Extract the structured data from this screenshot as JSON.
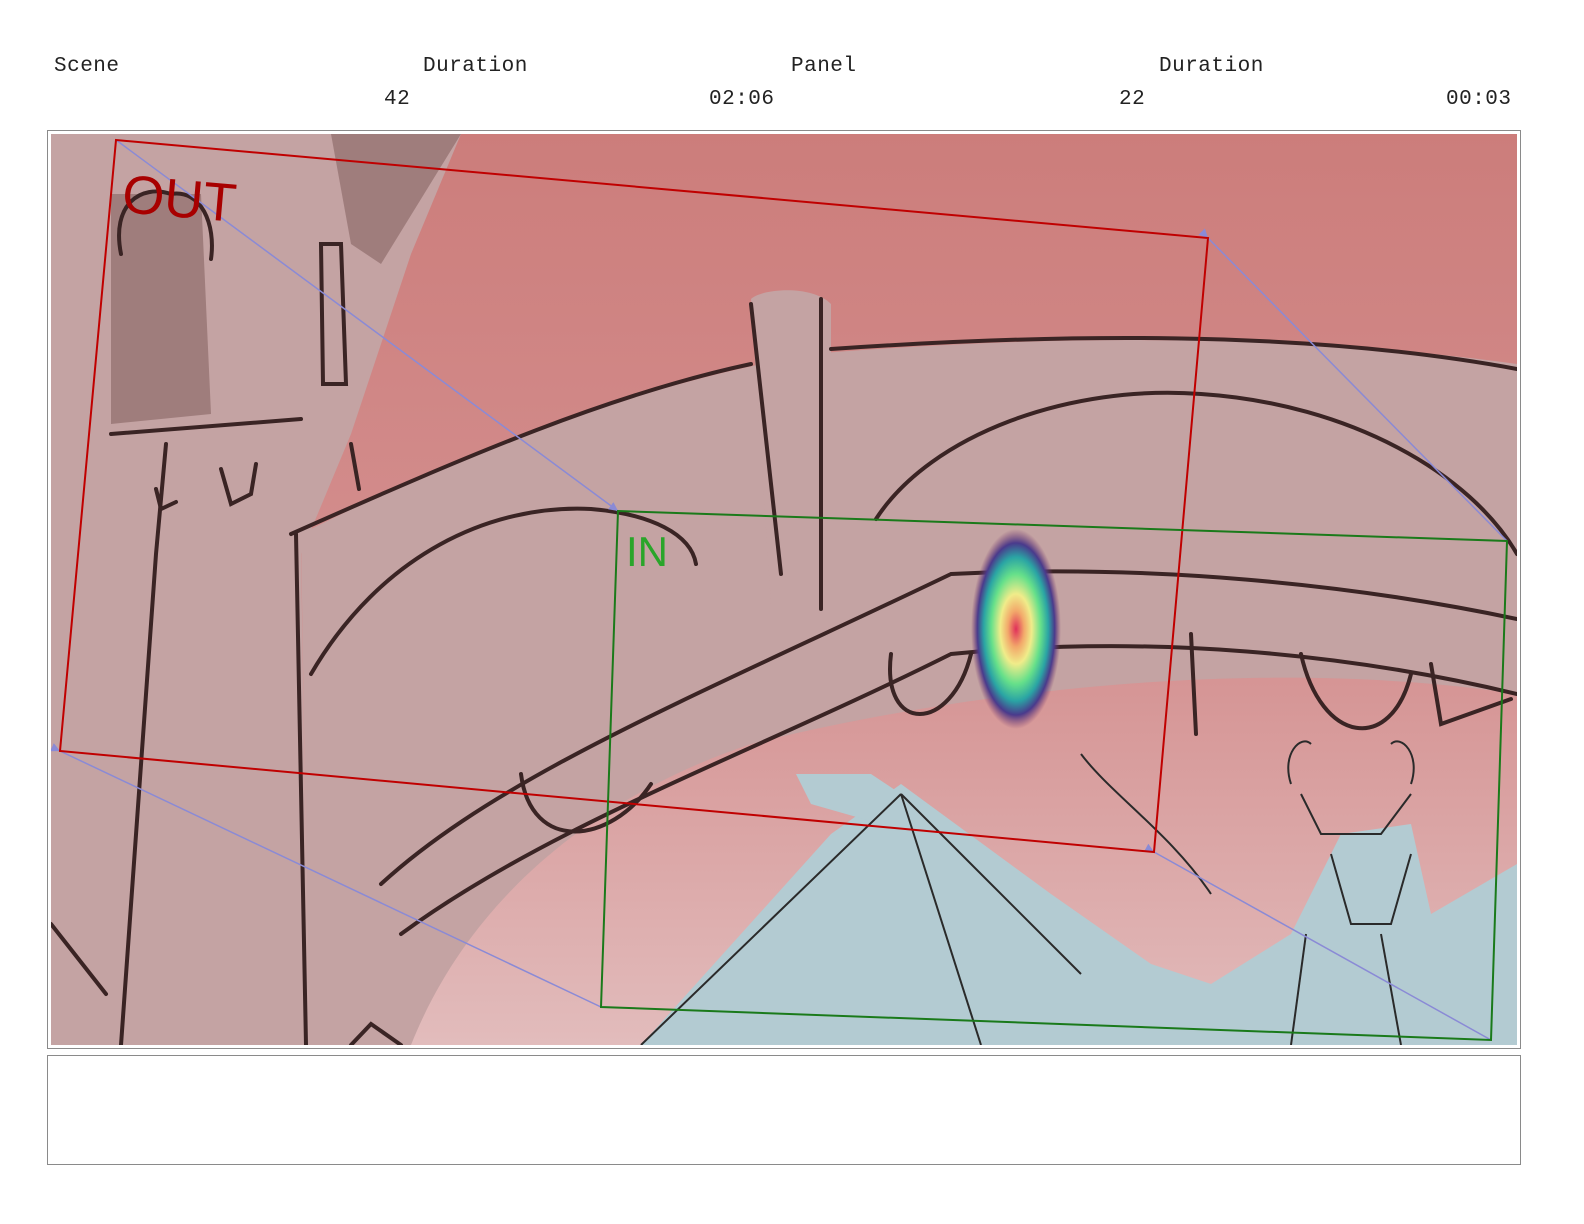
{
  "header": {
    "scene_label": "Scene",
    "scene_duration_label": "Duration",
    "panel_label": "Panel",
    "panel_duration_label": "Duration",
    "scene_value": "42",
    "scene_duration_value": "02:06",
    "panel_value": "22",
    "panel_duration_value": "00:03"
  },
  "panel": {
    "camera_out_label": "OUT",
    "camera_in_label": "IN",
    "colors": {
      "out_frame": "#c00000",
      "in_frame": "#1a7a1a",
      "sky": "#cf8480",
      "stone": "#c4a3a3",
      "line": "#3a2424",
      "figure": "#b3cbd2",
      "motion_path": "#8a8ad6"
    }
  },
  "notes": {
    "text": ""
  }
}
